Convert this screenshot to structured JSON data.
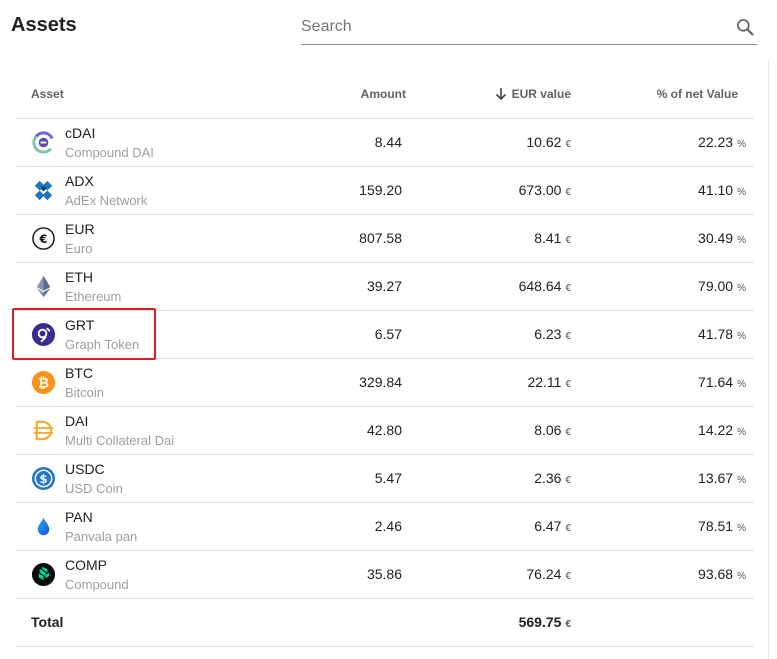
{
  "header": {
    "title": "Assets"
  },
  "search": {
    "placeholder": "Search",
    "value": ""
  },
  "columns": {
    "asset": "Asset",
    "amount": "Amount",
    "eur_value": "EUR value",
    "pct": "% of net Value"
  },
  "rows": [
    {
      "symbol": "cDAI",
      "name": "Compound DAI",
      "amount": "8.44",
      "eur": "10.62",
      "pct": "22.23",
      "icon": "cdai-icon"
    },
    {
      "symbol": "ADX",
      "name": "AdEx Network",
      "amount": "159.20",
      "eur": "673.00",
      "pct": "41.10",
      "icon": "adx-icon"
    },
    {
      "symbol": "EUR",
      "name": "Euro",
      "amount": "807.58",
      "eur": "8.41",
      "pct": "30.49",
      "icon": "euro-icon"
    },
    {
      "symbol": "ETH",
      "name": "Ethereum",
      "amount": "39.27",
      "eur": "648.64",
      "pct": "79.00",
      "icon": "ethereum-icon"
    },
    {
      "symbol": "GRT",
      "name": "Graph Token",
      "amount": "6.57",
      "eur": "6.23",
      "pct": "41.78",
      "icon": "graph-token-icon"
    },
    {
      "symbol": "BTC",
      "name": "Bitcoin",
      "amount": "329.84",
      "eur": "22.11",
      "pct": "71.64",
      "icon": "bitcoin-icon"
    },
    {
      "symbol": "DAI",
      "name": "Multi Collateral Dai",
      "amount": "42.80",
      "eur": "8.06",
      "pct": "14.22",
      "icon": "dai-icon"
    },
    {
      "symbol": "USDC",
      "name": "USD Coin",
      "amount": "5.47",
      "eur": "2.36",
      "pct": "13.67",
      "icon": "usdc-icon"
    },
    {
      "symbol": "PAN",
      "name": "Panvala pan",
      "amount": "2.46",
      "eur": "6.47",
      "pct": "78.51",
      "icon": "panvala-icon"
    },
    {
      "symbol": "COMP",
      "name": "Compound",
      "amount": "35.86",
      "eur": "76.24",
      "pct": "93.68",
      "icon": "compound-icon"
    }
  ],
  "units": {
    "currency": "€",
    "percent": "%"
  },
  "total": {
    "label": "Total",
    "eur": "569.75"
  },
  "colors": {
    "highlight": "#e01b24",
    "muted": "#9e9e9e",
    "divider": "#e0e0e0"
  }
}
